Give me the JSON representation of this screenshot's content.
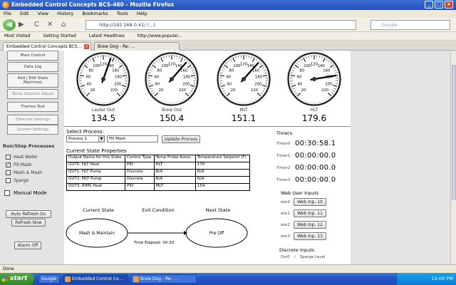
{
  "window": {
    "title": "Embedded Control Concepts BCS-460 - Mozilla Firefox",
    "min_label": "_",
    "max_label": "□",
    "close_label": "×"
  },
  "menu": [
    "File",
    "Edit",
    "View",
    "History",
    "Bookmarks",
    "Tools",
    "Help"
  ],
  "nav": {
    "back": "◀",
    "forward": "▶",
    "reload": "C",
    "stop": "✕",
    "home": "⌂",
    "url": "http://192.168.0.41/ (...)",
    "search_placeholder": "Google"
  },
  "bookmarks": [
    "Most Visited",
    "Getting Started",
    "Latest Headlines",
    "http://www.popular..."
  ],
  "tabs": [
    {
      "label": "Embedded Control Concepts BCS...",
      "close": "×"
    },
    {
      "label": "Brew Dog - Re: ..."
    }
  ],
  "sidebar": {
    "items": [
      {
        "label": "Main Control"
      },
      {
        "label": "Data Log"
      },
      {
        "label": "Add / Edit State Machines"
      },
      {
        "label": "Temp Setpoint Adjust"
      },
      {
        "label": "Thermo Test"
      },
      {
        "label": "Ethernet Settings"
      },
      {
        "label": "System Settings"
      }
    ],
    "run_stop_title": "Run/Stop Processes",
    "processes": [
      {
        "label": "Heat Water",
        "checked": false
      },
      {
        "label": "Fill Mash",
        "checked": true
      },
      {
        "label": "Mash & Mash",
        "checked": false
      },
      {
        "label": "Sparge",
        "checked": false
      }
    ],
    "manual_mode": "Manual Mode",
    "btn_auto": "Auto Refresh On",
    "btn_refresh": "Refresh Now",
    "btn_alarm": "Alarm Off"
  },
  "gauges": [
    {
      "name": "Lauter Out",
      "value": "134.5",
      "reading": 134.5
    },
    {
      "name": "Brew Out",
      "value": "150.4",
      "reading": 150.4
    },
    {
      "name": "MLT",
      "value": "151.1",
      "reading": 151.1
    },
    {
      "name": "HLT",
      "value": "179.6",
      "reading": 179.6
    }
  ],
  "gauge_ticks": [
    "20",
    "40",
    "60",
    "80",
    "100",
    "120",
    "140",
    "160",
    "180",
    "200",
    "220"
  ],
  "process": {
    "select_label": "Select Process:",
    "selected": "Process 1",
    "dropdown_arrow": "▼",
    "name": "Fill Mash",
    "update_button": "Update Process",
    "states_title": "Current State Properties"
  },
  "state_table": {
    "header": [
      "Output Name for this State",
      "Control Type",
      "Temp Probe Assoc.",
      "Temperature Setpoint (F)"
    ],
    "rows": [
      [
        "OUT0: HLT Heat",
        "PID",
        "HLT",
        "170"
      ],
      [
        "OUT1: HLT Pump",
        "Discrete",
        "N/A",
        "N/A"
      ],
      [
        "OUT2: MLT Pump",
        "Discrete",
        "N/A",
        "N/A"
      ],
      [
        "OUT3: RIMS Heat",
        "PID",
        "MLT",
        "154"
      ]
    ]
  },
  "timers": {
    "title": "Timers",
    "items": [
      {
        "label": "Timer0",
        "value": "00:30:58.1"
      },
      {
        "label": "Timer1",
        "value": "00:00:00.0"
      },
      {
        "label": "Timer2",
        "value": "00:00:00.0"
      },
      {
        "label": "Timer3",
        "value": "00:00:00.0"
      }
    ]
  },
  "web_inputs": {
    "title": "Web User Inputs",
    "items": [
      {
        "label": "win0",
        "button": "Web Inp. 10"
      },
      {
        "label": "win1",
        "button": "Web Inp. 11"
      },
      {
        "label": "win2",
        "button": "Web Inp. 12"
      },
      {
        "label": "win3",
        "button": "Web Inp. 13"
      }
    ]
  },
  "discrete_inputs": {
    "title": "Discrete Inputs",
    "label0": "Din0",
    "check": "✓",
    "label1": "Sparge Level"
  },
  "diagram": {
    "current_label": "Current State",
    "exit_label": "Exit Condition",
    "next_label": "Next State",
    "current_state": "Mash & Maintain",
    "next_state": "Pre Off",
    "exit_condition": "Time Elapsed: 00:30"
  },
  "statusbar": {
    "text": "Done"
  },
  "taskbar": {
    "start": "start",
    "items": [
      "Google",
      "Embedded Control Co...",
      "Brew Dog - Re: ..."
    ],
    "clock": "12:00 PM"
  },
  "colors": {
    "titlebar": "#1f4fb8",
    "taskbar": "#2456c8",
    "start": "#2e8a25",
    "needle": "#000000"
  }
}
